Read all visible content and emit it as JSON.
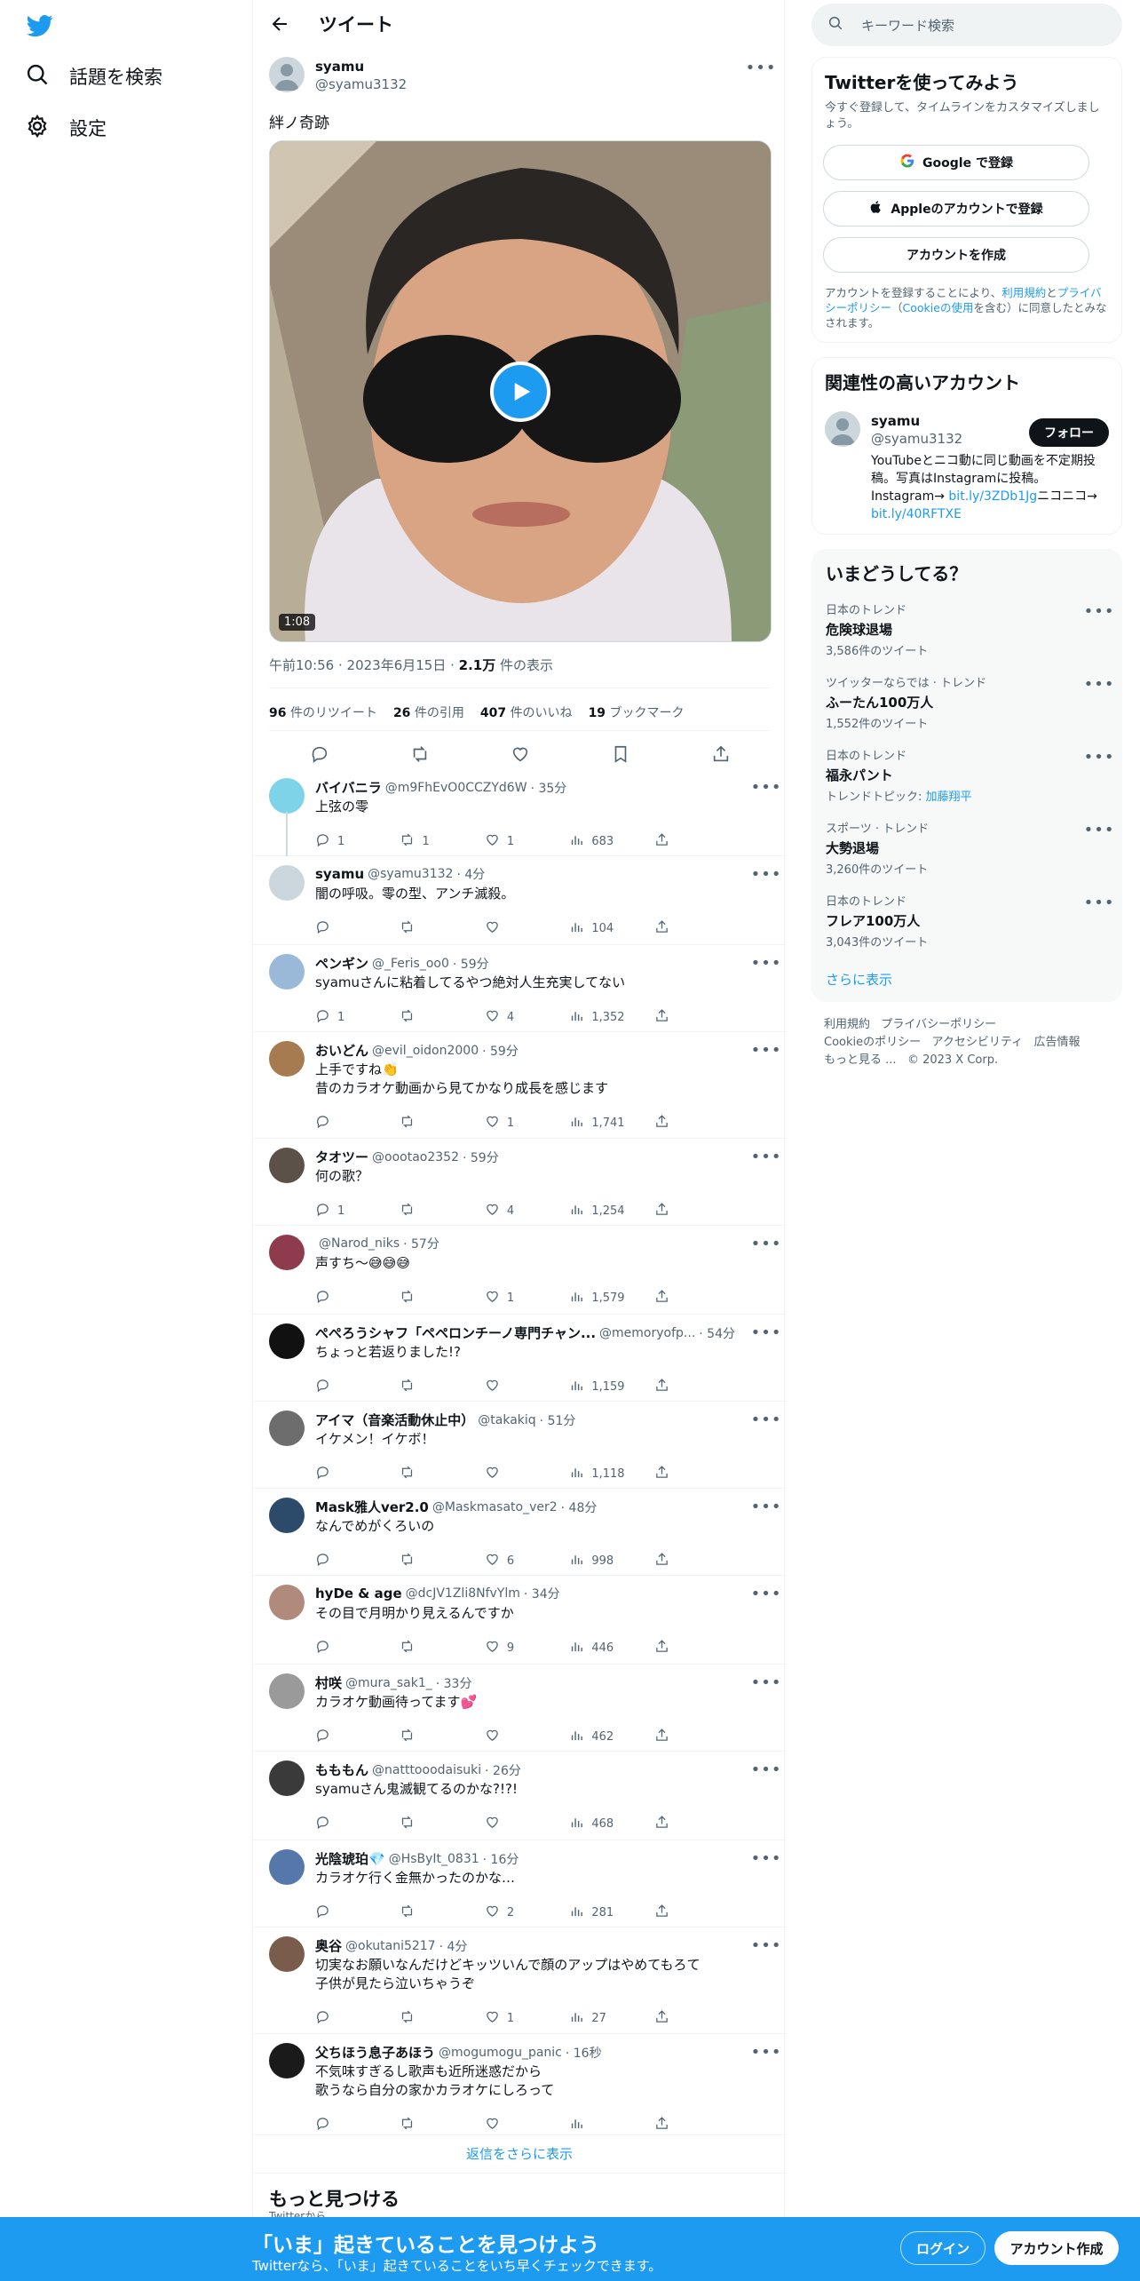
{
  "nav": {
    "explore": "話題を検索",
    "settings": "設定"
  },
  "header": {
    "title": "ツイート"
  },
  "tweet": {
    "name": "syamu",
    "handle": "@syamu3132",
    "text": "絆ノ奇跡",
    "duration": "1:08",
    "time": "午前10:56",
    "date": "2023年6月15日",
    "views_num": "2.1万",
    "views_label": "件の表示",
    "retweets": "96",
    "retweets_label": "件のリツイート",
    "quotes": "26",
    "quotes_label": "件の引用",
    "likes": "407",
    "likes_label": "件のいいね",
    "bookmarks": "19",
    "bookmarks_label": "ブックマーク"
  },
  "replies": [
    {
      "name": "バイバニラ",
      "handle": "@m9FhEvO0CCZYd6W",
      "time": "· 35分",
      "text": "上弦の零",
      "reply": "1",
      "rt": "1",
      "like": "1",
      "views": "683",
      "avatar_color": "#7fd3e8"
    },
    {
      "name": "syamu",
      "handle": "@syamu3132",
      "time": "· 4分",
      "text": "闇の呼吸。零の型、アンチ滅殺。",
      "reply": "",
      "rt": "",
      "like": "",
      "views": "104",
      "avatar_color": "#ccd6dd"
    },
    {
      "name": "ペンギン",
      "handle": "@_Feris_oo0",
      "time": "· 59分",
      "text": "syamuさんに粘着してるやつ絶対人生充実してない",
      "reply": "1",
      "rt": "",
      "like": "4",
      "views": "1,352",
      "avatar_color": "#9ab8d8"
    },
    {
      "name": "おいどん",
      "handle": "@evil_oidon2000",
      "time": "· 59分",
      "text": "上手ですね👏\n昔のカラオケ動画から見てかなり成長を感じます",
      "reply": "",
      "rt": "",
      "like": "1",
      "views": "1,741",
      "avatar_color": "#a67b4f"
    },
    {
      "name": "タオツー",
      "handle": "@oootao2352",
      "time": "· 59分",
      "text": "何の歌？",
      "reply": "1",
      "rt": "",
      "like": "4",
      "views": "1,254",
      "avatar_color": "#5b5148"
    },
    {
      "name": "",
      "handle": "@Narod_niks",
      "time": "· 57分",
      "text": "声すち〜😅😅😅",
      "reply": "",
      "rt": "",
      "like": "1",
      "views": "1,579",
      "avatar_color": "#8e3b4d"
    },
    {
      "name": "ぺぺろうシャフ「ペペロンチーノ専門チャン...",
      "handle": "@memoryofp...",
      "time": "· 54分",
      "text": "ちょっと若返りました!?",
      "reply": "",
      "rt": "",
      "like": "",
      "views": "1,159",
      "avatar_color": "#111111"
    },
    {
      "name": "アイマ（音楽活動休止中）",
      "handle": "@takakiq",
      "time": "· 51分",
      "text": "イケメン！イケボ！",
      "reply": "",
      "rt": "",
      "like": "",
      "views": "1,118",
      "avatar_color": "#6d6d6d"
    },
    {
      "name": "Mask雅人ver2.0",
      "handle": "@Maskmasato_ver2",
      "time": "· 48分",
      "text": "なんでめがくろいの",
      "reply": "",
      "rt": "",
      "like": "6",
      "views": "998",
      "avatar_color": "#2c4a6a"
    },
    {
      "name": "hyDe & age",
      "handle": "@dcJV1Zli8NfvYlm",
      "time": "· 34分",
      "text": "その目で月明かり見えるんですか",
      "reply": "",
      "rt": "",
      "like": "9",
      "views": "446",
      "avatar_color": "#b08a7a"
    },
    {
      "name": "村咲",
      "handle": "@mura_sak1_",
      "time": "· 33分",
      "text": "カラオケ動画待ってます💕",
      "reply": "",
      "rt": "",
      "like": "",
      "views": "462",
      "avatar_color": "#9a9a9a"
    },
    {
      "name": "もももん",
      "handle": "@natttooodaisuki",
      "time": "· 26分",
      "text": "syamuさん鬼滅観てるのかな?!?!",
      "reply": "",
      "rt": "",
      "like": "",
      "views": "468",
      "avatar_color": "#3a3a3a"
    },
    {
      "name": "光陰琥珀💎",
      "handle": "@HsByIt_0831",
      "time": "· 16分",
      "text": "カラオケ行く金無かったのかな…",
      "reply": "",
      "rt": "",
      "like": "2",
      "views": "281",
      "avatar_color": "#5577aa"
    },
    {
      "name": "奥谷",
      "handle": "@okutani5217",
      "time": "· 4分",
      "text": "切実なお願いなんだけどキッツいんで顔のアップはやめてもろて\n子供が見たら泣いちゃうぞ",
      "reply": "",
      "rt": "",
      "like": "1",
      "views": "27",
      "avatar_color": "#7a5c4c"
    },
    {
      "name": "父ちほう息子あほう",
      "handle": "@mogumogu_panic",
      "time": "· 16秒",
      "text": "不気味すぎるし歌声も近所迷惑だから\n歌うなら自分の家かカラオケにしろって",
      "reply": "",
      "rt": "",
      "like": "",
      "views": "",
      "avatar_color": "#1a1a1a"
    }
  ],
  "show_more": "返信をさらに表示",
  "more_find": "もっと見つける",
  "more_find_sub": "Twitterから",
  "right": {
    "search_placeholder": "キーワード検索",
    "signup": {
      "title": "Twitterを使ってみよう",
      "desc": "今すぐ登録して、タイムラインをカスタマイズしましょう。",
      "google": "Google で登録",
      "apple": "Appleのアカウントで登録",
      "create": "アカウントを作成",
      "terms_pre": "アカウントを登録することにより、",
      "terms_link": "利用規約",
      "terms_and": "と",
      "privacy_link": "プライバシーポリシー",
      "cookie_pre": "（",
      "cookie_link": "Cookieの使用",
      "terms_post": "を含む）に同意したとみなされます。"
    },
    "related": {
      "title": "関連性の高いアカウント",
      "name": "syamu",
      "handle": "@syamu3132",
      "follow": "フォロー",
      "bio1": "YouTubeとニコ動に同じ動画を不定期投稿。写真はInstagramに投稿。",
      "bio_insta": "Instagram→",
      "link1": "bit.ly/3ZDb1Jg",
      "bio_nico": "ニコニコ→",
      "link2": "bit.ly/40RFTXE"
    },
    "trends_title": "いまどうしてる？",
    "trends": [
      {
        "category": "日本のトレンド",
        "name": "危険球退場",
        "count": "3,586件のツイート"
      },
      {
        "category": "ツイッターならでは · トレンド",
        "name": "ふーたん100万人",
        "count": "1,552件のツイート"
      },
      {
        "category": "日本のトレンド",
        "name": "福永パント",
        "count": "トレンドトピック: ",
        "topic": "加藤翔平"
      },
      {
        "category": "スポーツ · トレンド",
        "name": "大勢退場",
        "count": "3,260件のツイート"
      },
      {
        "category": "日本のトレンド",
        "name": "フレア100万人",
        "count": "3,043件のツイート"
      }
    ],
    "trends_more": "さらに表示",
    "footer": {
      "l1": "利用規約",
      "l2": "プライバシーポリシー",
      "l3": "Cookieのポリシー",
      "l4": "アクセシビリティ",
      "l5": "広告情報",
      "l6": "もっと見る ...",
      "l7": "© 2023 X Corp."
    }
  },
  "banner": {
    "title": "「いま」起きていることを見つけよう",
    "sub": "Twitterなら、「いま」起きていることをいち早くチェックできます。",
    "login": "ログイン",
    "signup": "アカウント作成"
  },
  "colors": {
    "accent": "#1d9bf0",
    "text": "#0f1419",
    "muted": "#536471"
  }
}
